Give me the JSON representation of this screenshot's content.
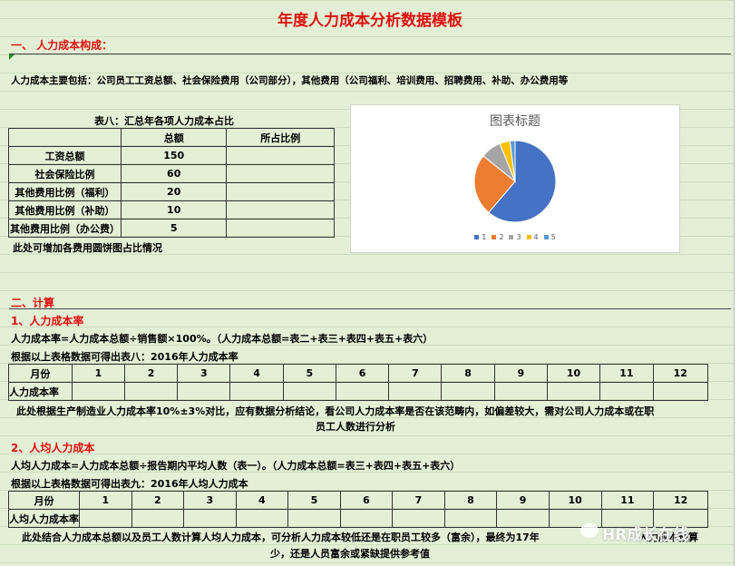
{
  "title": "年度人力成本分析数据模板",
  "section1": {
    "heading": "一、  人力成本构成：",
    "intro": "人力成本主要包括：公司员工工资总额、社会保险费用（公司部分），其他费用（公司福利、培训费用、招聘费用、补助、办公费用等",
    "table8_title": "表八：汇总年各项人力成本占比",
    "table8_headers": [
      "",
      "总额",
      "所占比例"
    ],
    "table8_rows": [
      {
        "label": "工资总额",
        "amount": "150",
        "ratio": ""
      },
      {
        "label": "社会保险比例",
        "amount": "60",
        "ratio": ""
      },
      {
        "label": "其他费用比例（福利）",
        "amount": "20",
        "ratio": ""
      },
      {
        "label": "其他费用比例（补助）",
        "amount": "10",
        "ratio": ""
      },
      {
        "label": "其他费用比例（办公费）",
        "amount": "5",
        "ratio": ""
      }
    ],
    "note": "此处可增加各费用圆饼图占比情况"
  },
  "chart_data": {
    "type": "pie",
    "title": "图表标题",
    "categories": [
      "1",
      "2",
      "3",
      "4",
      "5"
    ],
    "values": [
      150,
      60,
      20,
      10,
      5
    ],
    "colors": [
      "#4472c4",
      "#ed7d31",
      "#a5a5a5",
      "#ffc000",
      "#5b9bd5"
    ],
    "legend": "bottom"
  },
  "section2": {
    "heading": "二、计算",
    "sub1": {
      "heading": "1、人力成本率",
      "formula": "人力成本率=人力成本总额÷销售额×100%。（人力成本总额=表二+表三+表四+表五+表六）",
      "table_title": "根据以上表格数据可得出表八：2016年人力成本率",
      "header_label": "月份",
      "months": [
        "1",
        "2",
        "3",
        "4",
        "5",
        "6",
        "7",
        "8",
        "9",
        "10",
        "11",
        "12"
      ],
      "row_label": "人力成本率",
      "note_line1": "此处根据生产制造业人力成本率10%±3%对比，应有数据分析结论，看公司人力成本率是否在该范畴内，如偏差较大，需对公司人力成本或在职",
      "note_line2": "员工人数进行分析"
    },
    "sub2": {
      "heading": "2、人均人力成本",
      "formula": "人均人力成本=人力成本总额÷报告期内平均人数（表一）。（人力成本总额=表三+表四+表五+表六）",
      "table_title": "根据以上表格数据可得出表九：2016年人均人力成本",
      "header_label": "月份",
      "months": [
        "1",
        "2",
        "3",
        "4",
        "5",
        "6",
        "7",
        "8",
        "9",
        "10",
        "11",
        "12"
      ],
      "row_label": "人均人力成本率",
      "note_line1": "此处结合人力成本总额以及员工人数计算人均人力成本，可分析人力成本较低还是在职员工较多（富余），最终为17年",
      "note_line1b": "人力成本预算",
      "note_line2": "少，还是人员富余或紧缺提供参考值"
    }
  },
  "watermark": "HR成长在线"
}
